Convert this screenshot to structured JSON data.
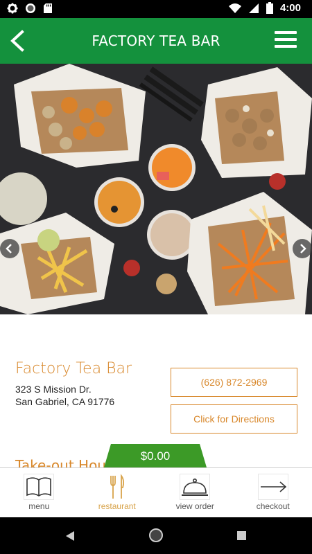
{
  "status_bar": {
    "time": "4:00",
    "icons": [
      "gear-icon",
      "record-icon",
      "sd-card-icon",
      "wifi-icon",
      "signal-icon",
      "battery-icon"
    ]
  },
  "app_bar": {
    "title": "FACTORY TEA BAR",
    "back_icon": "chevron-left-icon",
    "menu_icon": "hamburger-icon",
    "color": "#14913d"
  },
  "hero": {
    "prev_icon": "chevron-left-icon",
    "next_icon": "chevron-right-icon"
  },
  "restaurant": {
    "name": "Factory Tea Bar",
    "address_line1": "323 S Mission Dr.",
    "address_line2": "San Gabriel, CA 91776",
    "phone": "(626) 872-2969",
    "directions_label": "Click for Directions",
    "takeout_heading": "Take-out Hours",
    "accent_color": "#d8872a"
  },
  "cart": {
    "total": "$0.00"
  },
  "bottom_nav": {
    "items": [
      {
        "label": "menu",
        "icon": "book-icon",
        "active": false
      },
      {
        "label": "restaurant",
        "icon": "fork-knife-icon",
        "active": true
      },
      {
        "label": "view order",
        "icon": "cloche-icon",
        "active": false
      },
      {
        "label": "checkout",
        "icon": "arrow-right-icon",
        "active": false
      }
    ]
  }
}
